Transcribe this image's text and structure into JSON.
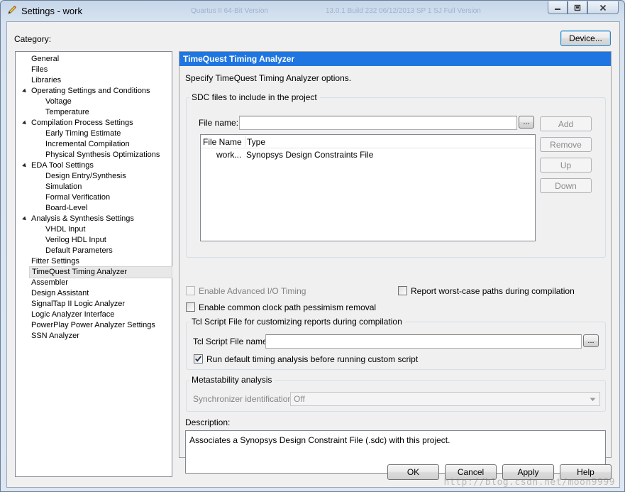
{
  "window": {
    "title": "Settings - work",
    "ghost_left": "Quartus II 64-Bit Version",
    "ghost_right": "13.0.1 Build 232 06/12/2013 SP 1 SJ Full Version"
  },
  "category_label": "Category:",
  "device_button": "Device...",
  "tree": [
    {
      "label": "General",
      "level": 0
    },
    {
      "label": "Files",
      "level": 0
    },
    {
      "label": "Libraries",
      "level": 0
    },
    {
      "label": "Operating Settings and Conditions",
      "level": 0,
      "expanded": true
    },
    {
      "label": "Voltage",
      "level": 1
    },
    {
      "label": "Temperature",
      "level": 1
    },
    {
      "label": "Compilation Process Settings",
      "level": 0,
      "expanded": true
    },
    {
      "label": "Early Timing Estimate",
      "level": 1
    },
    {
      "label": "Incremental Compilation",
      "level": 1
    },
    {
      "label": "Physical Synthesis Optimizations",
      "level": 1
    },
    {
      "label": "EDA Tool Settings",
      "level": 0,
      "expanded": true
    },
    {
      "label": "Design Entry/Synthesis",
      "level": 1
    },
    {
      "label": "Simulation",
      "level": 1
    },
    {
      "label": "Formal Verification",
      "level": 1
    },
    {
      "label": "Board-Level",
      "level": 1
    },
    {
      "label": "Analysis & Synthesis Settings",
      "level": 0,
      "expanded": true
    },
    {
      "label": "VHDL Input",
      "level": 1
    },
    {
      "label": "Verilog HDL Input",
      "level": 1
    },
    {
      "label": "Default Parameters",
      "level": 1
    },
    {
      "label": "Fitter Settings",
      "level": 0
    },
    {
      "label": "TimeQuest Timing Analyzer",
      "level": 0,
      "selected": true
    },
    {
      "label": "Assembler",
      "level": 0
    },
    {
      "label": "Design Assistant",
      "level": 0
    },
    {
      "label": "SignalTap II Logic Analyzer",
      "level": 0
    },
    {
      "label": "Logic Analyzer Interface",
      "level": 0
    },
    {
      "label": "PowerPlay Power Analyzer Settings",
      "level": 0
    },
    {
      "label": "SSN Analyzer",
      "level": 0
    }
  ],
  "panel": {
    "header": "TimeQuest Timing Analyzer",
    "intro": "Specify TimeQuest Timing Analyzer options.",
    "sdc_group": "SDC files to include in the project",
    "file_name_label": "File name:",
    "file_name_value": "",
    "browse_label": "...",
    "add": "Add",
    "remove": "Remove",
    "up": "Up",
    "down": "Down",
    "columns": [
      "File Name",
      "Type"
    ],
    "rows": [
      {
        "file": "work...",
        "type": "Synopsys Design Constraints File"
      }
    ],
    "enable_advanced_io": "Enable Advanced I/O Timing",
    "report_worst_case": "Report worst-case paths during compilation",
    "enable_ccpp": "Enable common clock path pessimism removal",
    "tcl_group": "Tcl Script File for customizing reports during compilation",
    "tcl_label": "Tcl Script File name:",
    "tcl_value": "",
    "run_default": "Run default timing analysis before running custom script",
    "run_default_checked": true,
    "meta_group": "Metastability analysis",
    "sync_label": "Synchronizer identification:",
    "sync_value": "Off",
    "description_label": "Description:",
    "description_text": "Associates a Synopsys Design Constraint File (.sdc) with this project."
  },
  "footer": {
    "ok": "OK",
    "cancel": "Cancel",
    "apply": "Apply",
    "help": "Help"
  },
  "watermark": "http://blog.csdn.net/moon9999"
}
